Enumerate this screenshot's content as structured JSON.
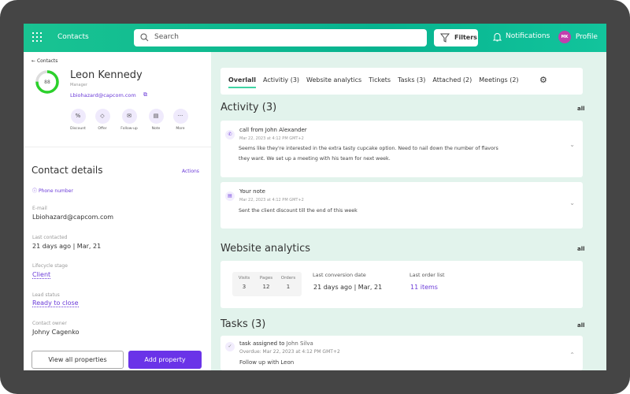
{
  "header": {
    "app": "Contacts",
    "search_placeholder": "Search",
    "filters": "Filters",
    "notifications": "Notifications",
    "profile": "Profile",
    "avatar_initials": "MK"
  },
  "contact": {
    "back": "Contacts",
    "score": "88",
    "score_pct": 75,
    "name": "Leon Kennedy",
    "role": "Manager",
    "email": "Lbiohazard@capcom.com",
    "actions": [
      {
        "icon": "%",
        "label": "Discount"
      },
      {
        "icon": "◇",
        "label": "Offer"
      },
      {
        "icon": "✉",
        "label": "Follow-up"
      },
      {
        "icon": "▤",
        "label": "Note"
      },
      {
        "icon": "···",
        "label": "More"
      }
    ]
  },
  "details": {
    "title": "Contact details",
    "actions": "Actions",
    "phone": "Phone number",
    "email_label": "E-mail",
    "email": "Lbiohazard@capcom.com",
    "last_contacted_label": "Last contacted",
    "last_contacted": "21 days ago |  Mar, 21",
    "lifecycle_label": "Lifecycle stage",
    "lifecycle": "Client",
    "lead_label": "Lead status",
    "lead": "Ready to close",
    "owner_label": "Contact owner",
    "owner": "Johny Cagenko",
    "view_all": "View all properties",
    "add": "Add property"
  },
  "tabs": [
    "Overlall",
    "Activitiy (3)",
    "Website analytics",
    "Tickets",
    "Tasks (3)",
    "Attached (2)",
    "Meetings (2)"
  ],
  "activity": {
    "title": "Activity (3)",
    "all": "all",
    "items": [
      {
        "title": "call from John Alexander",
        "time": "Mar 22, 2023 at 4:12 PM GMT+2",
        "text1": "Seems like they're interested in the extra tasty cupcake option. Need to nail down the number of flavors",
        "text2": "they want. We set up a meeting with his team for next week."
      },
      {
        "title": "Your note",
        "time": "Mar 22, 2023 at 4:12 PM GMT+2",
        "text1": "Sent the client discount till the end of this week"
      }
    ]
  },
  "analytics": {
    "title": "Website analytics",
    "all": "all",
    "visits_label": "Visits",
    "visits": "3",
    "pages_label": "Pages",
    "pages": "12",
    "orders_label": "Orders",
    "orders": "1",
    "conv_label": "Last conversion date",
    "conv": "21 days ago |  Mar, 21",
    "order_label": "Last order list",
    "order": "11 items"
  },
  "tasks": {
    "title": "Tasks (3)",
    "all": "all",
    "item": {
      "prefix": "task assigned to",
      "person": "John Silva",
      "time": "Overdue: Mar 22, 2023 at 4:12 PM GMT+2",
      "text": "Follow up with Leon"
    }
  },
  "colors": {
    "accent": "#6b3bd8",
    "header": "#07b38f",
    "panel": "#e2f3ec"
  }
}
